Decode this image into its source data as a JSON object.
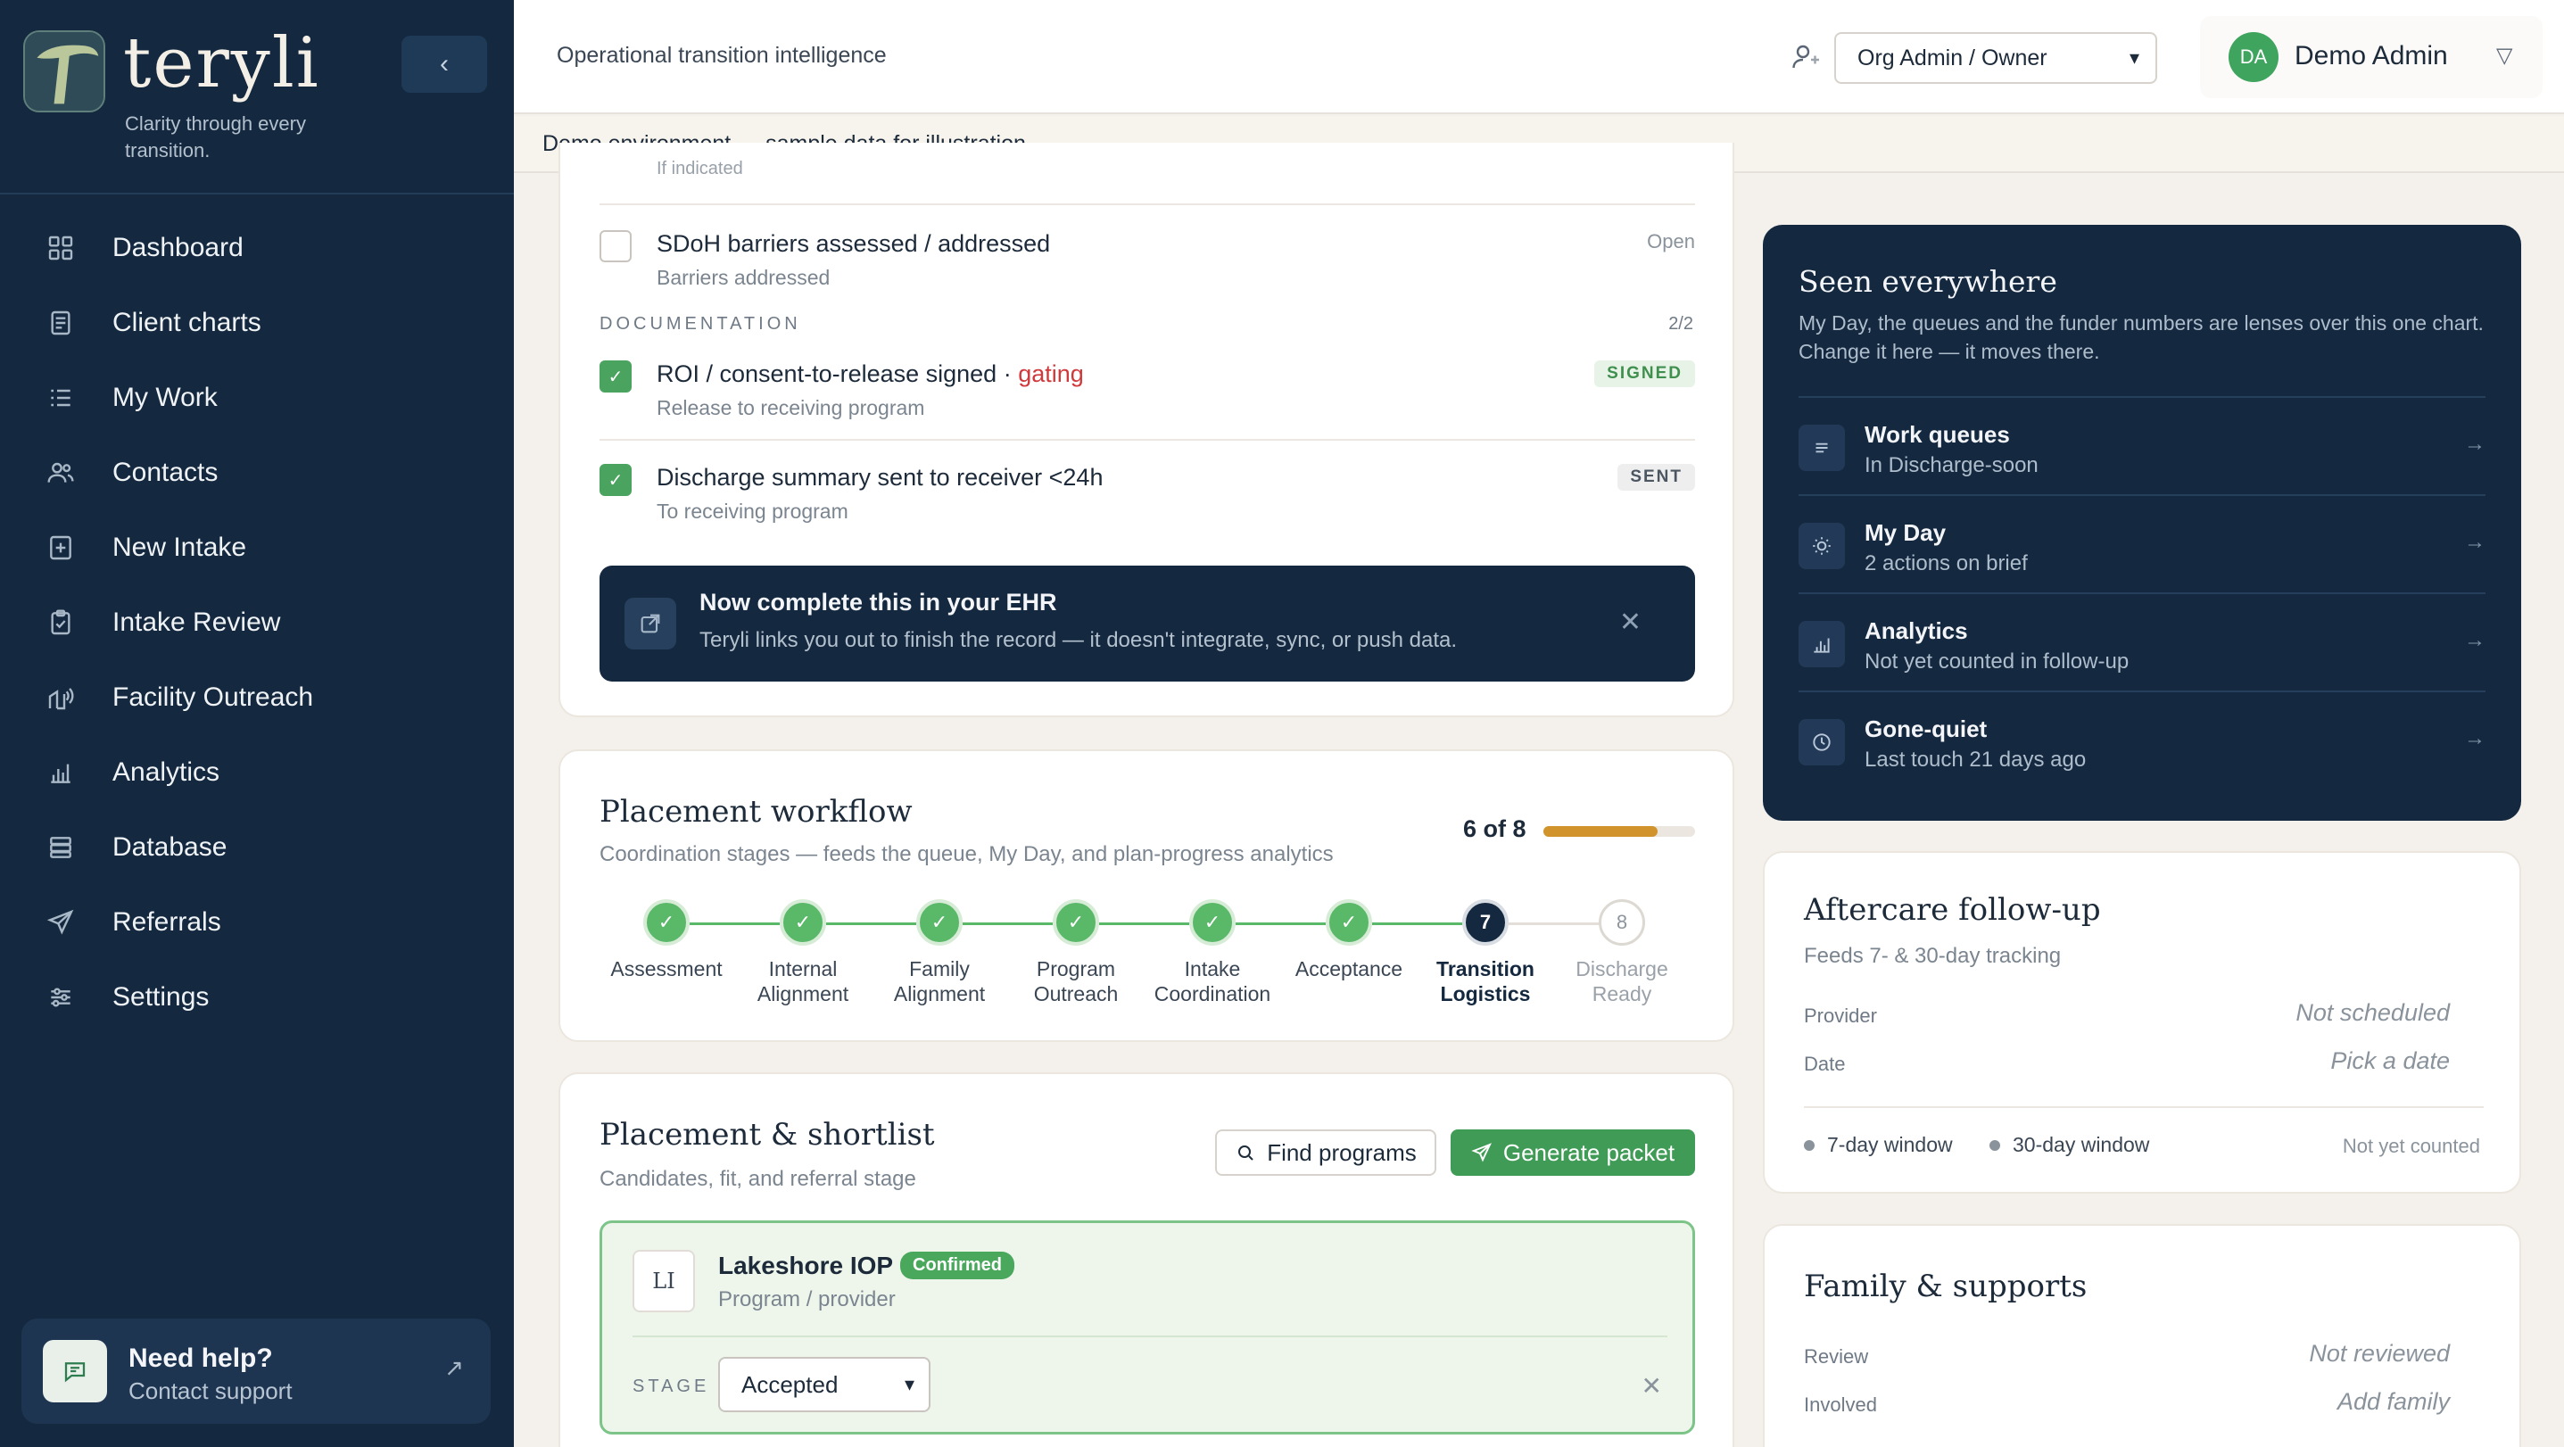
{
  "sidebar": {
    "brand_name": "teryli",
    "tagline": "Clarity through every transition.",
    "collapse_icon": "chevron-left-icon",
    "items": [
      {
        "label": "Dashboard",
        "icon": "grid-icon"
      },
      {
        "label": "Client charts",
        "icon": "document-icon"
      },
      {
        "label": "My Work",
        "icon": "list-icon"
      },
      {
        "label": "Contacts",
        "icon": "people-icon"
      },
      {
        "label": "New Intake",
        "icon": "plus-square-icon"
      },
      {
        "label": "Intake Review",
        "icon": "clipboard-check-icon"
      },
      {
        "label": "Facility Outreach",
        "icon": "outreach-icon"
      },
      {
        "label": "Analytics",
        "icon": "bar-chart-icon"
      },
      {
        "label": "Database",
        "icon": "database-icon"
      },
      {
        "label": "Referrals",
        "icon": "send-icon"
      },
      {
        "label": "Settings",
        "icon": "sliders-icon"
      }
    ],
    "help": {
      "title": "Need help?",
      "subtitle": "Contact support",
      "arrow": "↗"
    }
  },
  "header": {
    "title": "Operational transition intelligence",
    "role_select": "Org Admin / Owner",
    "user_initials": "DA",
    "user_name": "Demo Admin"
  },
  "banner": "Demo environment — sample data for illustration.",
  "checklist": {
    "cut_text": "If indicated",
    "sdoh": {
      "title": "SDoH barriers assessed / addressed",
      "subtitle": "Barriers addressed",
      "status": "Open"
    },
    "documentation_label": "DOCUMENTATION",
    "documentation_count": "2/2",
    "roi": {
      "title": "ROI / consent-to-release signed ·",
      "gating": "gating",
      "subtitle": "Release to receiving program",
      "pill": "SIGNED"
    },
    "discharge": {
      "title": "Discharge summary sent to receiver <24h",
      "subtitle": "To receiving program",
      "pill": "SENT"
    },
    "check_glyph": "✓"
  },
  "ehr_notice": {
    "title": "Now complete this in your EHR",
    "subtitle": "Teryli links you out to finish the record — it doesn't integrate, sync, or push data.",
    "close": "✕"
  },
  "placement_workflow": {
    "title": "Placement workflow",
    "subtitle": "Coordination stages — feeds the queue, My Day, and plan-progress analytics",
    "progress_text": "6 of 8",
    "progress_done": 6,
    "progress_total": 8,
    "progress_color": "#d1932c",
    "steps": [
      {
        "label": "Assessment",
        "state": "done",
        "mark": "✓"
      },
      {
        "label": "Internal Alignment",
        "state": "done",
        "mark": "✓"
      },
      {
        "label": "Family Alignment",
        "state": "done",
        "mark": "✓"
      },
      {
        "label": "Program Outreach",
        "state": "done",
        "mark": "✓"
      },
      {
        "label": "Intake Coordination",
        "state": "done",
        "mark": "✓"
      },
      {
        "label": "Acceptance",
        "state": "done",
        "mark": "✓"
      },
      {
        "label": "Transition Logistics",
        "state": "current",
        "mark": "7"
      },
      {
        "label": "Discharge Ready",
        "state": "todo",
        "mark": "8"
      }
    ]
  },
  "shortlist": {
    "title": "Placement & shortlist",
    "subtitle": "Candidates, fit, and referral stage",
    "find_button": "Find programs",
    "generate_button": "Generate packet",
    "candidate": {
      "initials": "LI",
      "name": "Lakeshore IOP",
      "badge": "Confirmed",
      "subtitle": "Program / provider",
      "stage_label": "STAGE",
      "stage_value": "Accepted",
      "close": "✕"
    }
  },
  "seen_everywhere": {
    "title": "Seen everywhere",
    "subtitle": "My Day, the queues and the funder numbers are lenses over this one chart. Change it here — it moves there.",
    "items": [
      {
        "name": "Work queues",
        "desc": "In Discharge-soon",
        "icon": "queue-icon"
      },
      {
        "name": "My Day",
        "desc": "2 actions on brief",
        "icon": "sun-icon"
      },
      {
        "name": "Analytics",
        "desc": "Not yet counted in follow-up",
        "icon": "bar-chart-icon"
      },
      {
        "name": "Gone-quiet",
        "desc": "Last touch 21 days ago",
        "icon": "clock-icon"
      }
    ],
    "arrow": "→"
  },
  "aftercare": {
    "title": "Aftercare follow-up",
    "subtitle": "Feeds 7- & 30-day tracking",
    "provider_label": "Provider",
    "provider_value": "Not scheduled",
    "date_label": "Date",
    "date_value": "Pick a date",
    "window_7": "7-day window",
    "window_30": "30-day window",
    "not_counted": "Not yet counted"
  },
  "family": {
    "title": "Family & supports",
    "review_label": "Review",
    "review_value": "Not reviewed",
    "involved_label": "Involved",
    "involved_value": "Add family"
  }
}
